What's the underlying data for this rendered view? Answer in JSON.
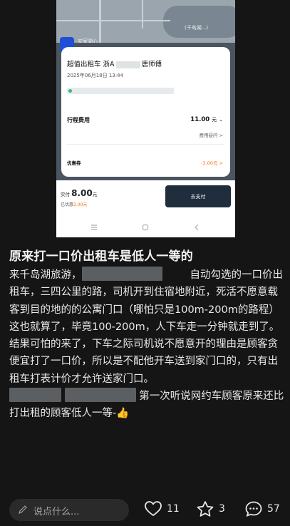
{
  "screenshot": {
    "map_label_1": "安家湖心",
    "map_label_2": "(千岛湖...)",
    "card": {
      "title_prefix": "超值出租车 浙A",
      "title_suffix": "唐师傅",
      "time": "2025年06月18日 13:44",
      "fee_label": "行程费用",
      "fee_value": "11.00",
      "fee_unit": "元",
      "fee_doubt": "费用疑问 >",
      "coupon_label": "优惠券",
      "coupon_value": "-3.00元 >"
    },
    "paybar": {
      "paid_prefix": "实付",
      "paid_amount": "8.00",
      "paid_unit": "元",
      "discount_prefix": "已优惠",
      "discount_value": "3.00元",
      "pay_button": "去支付"
    }
  },
  "post": {
    "title": "原来打一口价出租车是低人一等的",
    "p1_a": "来千岛湖旅游，",
    "p1_b": "自动勾选的一口价出租车，三四公里的路，司机开到住宿地附近，死活不愿意载客到目的地的的公寓门口（哪怕只是100m-200m的路程）",
    "p2": "这也就算了，毕竟100-200m，人下车走一分钟就走到了。",
    "p3": "结果可怕的来了，下车之际司机说不愿意开的理由是顾客贪便宜打了一口价，所以是不配他开车送到家门口的，只有出租车打表计价才允许送家门口。",
    "p4_b": "第一次听说网约车顾客原来还比打出租的顾客低人一等-",
    "emoji": "👍"
  },
  "bottom_bar": {
    "comment_placeholder": "说点什么...",
    "likes": "11",
    "stars": "3",
    "comments": "57"
  },
  "colors": {
    "pay_button_bg": "#1f2d3d",
    "orange": "#ff6a00",
    "page_bg": "#151515"
  }
}
